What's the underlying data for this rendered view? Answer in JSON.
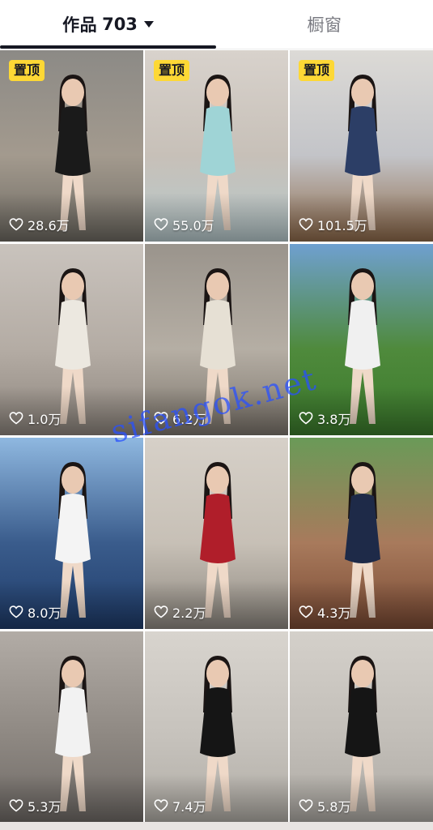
{
  "tabs": {
    "works_label": "作品",
    "works_count": "703",
    "window_label": "橱窗"
  },
  "pin_label": "置顶",
  "watermark_text": "sifangok.net",
  "items": [
    {
      "likes": "28.6万",
      "pinned": true,
      "bg": [
        "#8c8a86",
        "#a39a8e",
        "#6e6a62"
      ],
      "figure": "#1a1a1a"
    },
    {
      "likes": "55.0万",
      "pinned": true,
      "bg": [
        "#d8d2cc",
        "#c7c0b8",
        "#b7c9cc"
      ],
      "figure": "#9fd4d6"
    },
    {
      "likes": "101.5万",
      "pinned": true,
      "bg": [
        "#dcdad6",
        "#c3c4c8",
        "#8e6a4a"
      ],
      "figure": "#2c3e66"
    },
    {
      "likes": "1.0万",
      "pinned": false,
      "bg": [
        "#c9c3bd",
        "#b4aca4",
        "#8d857d"
      ],
      "figure": "#ece8e0"
    },
    {
      "likes": "6.2万",
      "pinned": false,
      "bg": [
        "#9a948c",
        "#b5aea4",
        "#7c756c"
      ],
      "figure": "#e6e0d4"
    },
    {
      "likes": "3.8万",
      "pinned": false,
      "bg": [
        "#6fa0d0",
        "#4f8a3c",
        "#3b7a2c"
      ],
      "figure": "#f0f0f0"
    },
    {
      "likes": "8.0万",
      "pinned": false,
      "bg": [
        "#8fb8e0",
        "#3a5c8c",
        "#1f3c6a"
      ],
      "figure": "#f4f4f4"
    },
    {
      "likes": "2.2万",
      "pinned": false,
      "bg": [
        "#d6d0c8",
        "#c7c0b6",
        "#8e8880"
      ],
      "figure": "#b01e2a"
    },
    {
      "likes": "4.3万",
      "pinned": false,
      "bg": [
        "#6a9a58",
        "#a87a5c",
        "#7a4a34"
      ],
      "figure": "#1e2a48"
    },
    {
      "likes": "5.3万",
      "pinned": false,
      "bg": [
        "#b2aca6",
        "#8e8882",
        "#6f6a66"
      ],
      "figure": "#f2f2f2"
    },
    {
      "likes": "7.4万",
      "pinned": false,
      "bg": [
        "#d8d4ce",
        "#c6c2bc",
        "#b1ada6"
      ],
      "figure": "#151515"
    },
    {
      "likes": "5.8万",
      "pinned": false,
      "bg": [
        "#d4d0ca",
        "#c2beb8",
        "#aeaaa4"
      ],
      "figure": "#151515"
    }
  ]
}
